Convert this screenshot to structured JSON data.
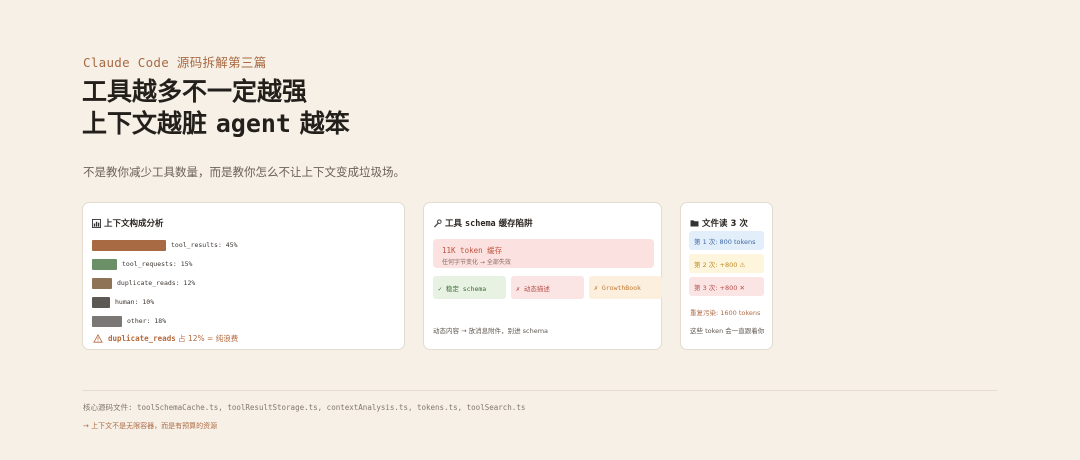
{
  "header": {
    "kicker": "Claude Code 源码拆解第三篇",
    "headline_line1": "工具越多不一定越强",
    "headline_line2_prefix": "上下文越脏 ",
    "headline_line2_code": "agent",
    "headline_line2_suffix": " 越笨",
    "subtitle": "不是教你减少工具数量，而是教你怎么不让上下文变成垃圾场。"
  },
  "card_context": {
    "icon": "bar-chart-icon",
    "title": "上下文构成分析",
    "bars": [
      {
        "label": "tool_results: 45%",
        "value": 45,
        "color": "#a86a43"
      },
      {
        "label": "tool_requests: 15%",
        "value": 15,
        "color": "#6b8f67"
      },
      {
        "label": "duplicate_reads: 12%",
        "value": 12,
        "color": "#8f7356"
      },
      {
        "label": "human: 10%",
        "value": 10,
        "color": "#5c5955"
      },
      {
        "label": "other: 18%",
        "value": 18,
        "color": "#7a7774"
      }
    ],
    "warning_icon": "warning-icon",
    "warning_code": "duplicate_reads",
    "warning_text": " 占 12% = 纯浪费"
  },
  "card_schema": {
    "icon": "wrench-icon",
    "title_prefix": "工具 ",
    "title_code": "schema",
    "title_suffix": " 缓存陷阱",
    "highlight_line1": "11K token 缓存",
    "highlight_line2": "任何字节变化 → 全部失效",
    "chips": [
      {
        "text": "✓ 稳定 schema",
        "bg": "#e7f2e3",
        "fg": "#3e6a3a"
      },
      {
        "text": "✗ 动态描述",
        "bg": "#fbe4e4",
        "fg": "#b4504a"
      },
      {
        "text": "✗ GrowthBook",
        "bg": "#fdefdd",
        "fg": "#c17a36"
      }
    ],
    "footer": "动态内容 → 放消息附件，别进 schema"
  },
  "card_reads": {
    "icon": "folder-icon",
    "title": "文件读 3 次",
    "reads": [
      {
        "text": "第 1 次: 800 tokens",
        "bg": "#e3eefb",
        "fg": "#3f6aa3"
      },
      {
        "text": "第 2 次: +800 ⚠",
        "bg": "#fdf5dc",
        "fg": "#c08a25"
      },
      {
        "text": "第 3 次: +800 ✕",
        "bg": "#fbe4e4",
        "fg": "#b4504a"
      }
    ],
    "pollution": "重复污染: 1600 tokens",
    "footer": "这些 token 会一直跟着你"
  },
  "footer": {
    "source_files": "核心源码文件: toolSchemaCache.ts, toolResultStorage.ts, contextAnalysis.ts, tokens.ts, toolSearch.ts",
    "note": "→ 上下文不是无限容器，而是有预算的资源"
  }
}
